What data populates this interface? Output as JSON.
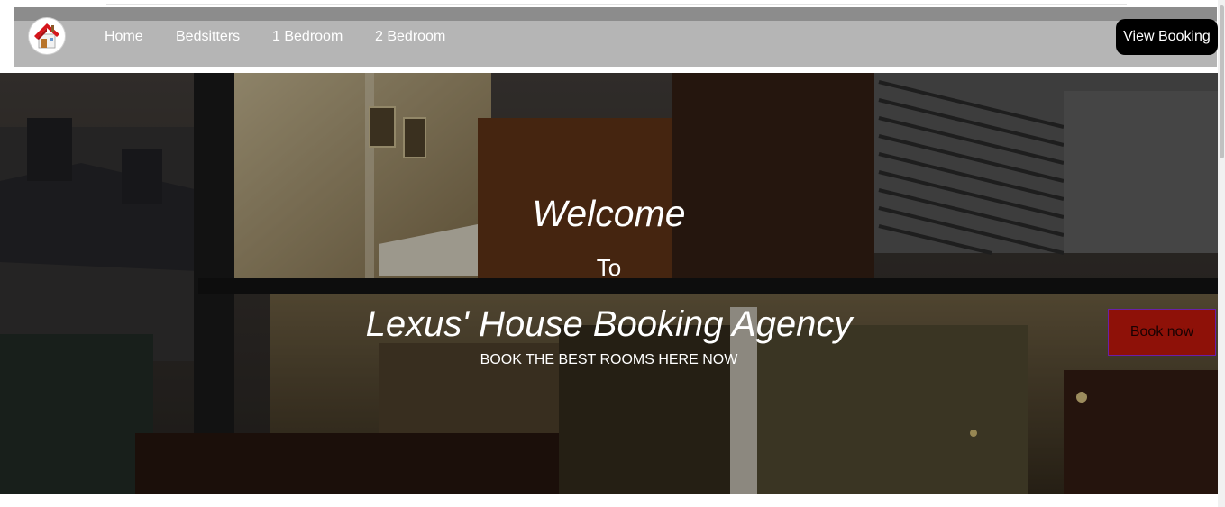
{
  "navbar": {
    "logo": "house-icon",
    "links": [
      "Home",
      "Bedsitters",
      "1 Bedroom",
      "2 Bedroom"
    ],
    "view_booking_label": "View Booking"
  },
  "hero": {
    "welcome": "Welcome",
    "to": "To",
    "agency": "Lexus' House Booking Agency",
    "tagline": "BOOK THE BEST ROOMS HERE NOW"
  },
  "book_now_label": "Book now",
  "colors": {
    "navbar_bg": "#b5b5b5",
    "view_booking_bg": "#000000",
    "book_now_bg": "#8e1108",
    "book_now_border": "#6a1fa8"
  }
}
